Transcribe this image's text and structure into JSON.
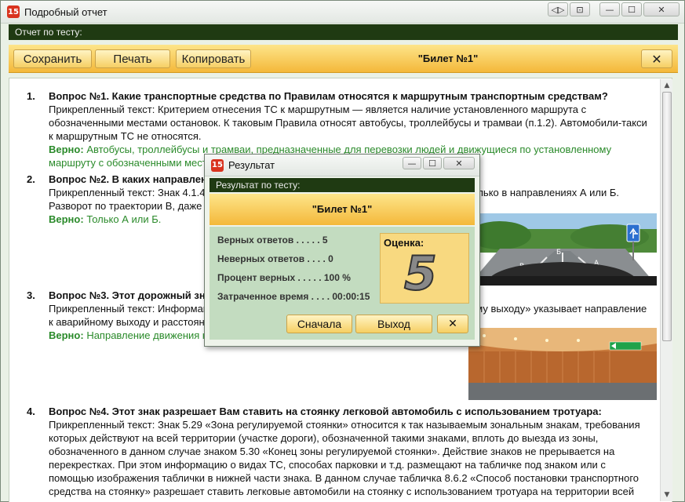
{
  "window": {
    "title": "Подробный отчет",
    "app_icon_text": "15",
    "controls": {
      "extra1": "◁▷",
      "extra2": "⊡",
      "min": "—",
      "max": "☐",
      "close": "✕"
    }
  },
  "report_header": "Отчет по тесту:",
  "toolbar": {
    "save": "Сохранить",
    "print": "Печать",
    "copy": "Копировать",
    "ticket": "\"Билет №1\"",
    "close": "✕"
  },
  "questions": [
    {
      "num": "1.",
      "title": "Вопрос №1. Какие транспортные средства по Правилам относятся к маршрутным транспортным средствам?",
      "text": "Прикрепленный текст: Критерием отнесения ТС к маршрутным — является наличие установленного маршрута с обозначенными местами остановок. К таковым Правила относят автобусы, троллейбусы и трамваи (п.1.2). Автомобили-такси к маршрутным ТС не относятся.",
      "correct_label": "Верно:",
      "correct": "Автобусы, троллейбусы и трамваи, предназначенные для перевозки людей и движущиеся по установленному маршруту с обозначенными местами остановок."
    },
    {
      "num": "2.",
      "title": "Вопрос №2. В каких направлениях Вам разрешено продолжить движение?",
      "text": "Прикрепленный текст: Знак 4.1.4 «Движение прямо или направо» разрешает движение только в направлениях А или Б. Разворот по траектории В, даже если это разрешено разметкой, запрещен.",
      "correct_label": "Верно:",
      "correct": "Только А или Б."
    },
    {
      "num": "3.",
      "title": "Вопрос №3. Этот дорожный знак указывает:",
      "text": "Прикрепленный текст: Информационный знак 6.18.3 «Направление движения к аварийному выходу» указывает направление к аварийному выходу и расстояние до него.",
      "correct_label": "Верно:",
      "correct": "Направление движения к аварийному выходу."
    },
    {
      "num": "4.",
      "title": "Вопрос №4. Этот знак разрешает Вам ставить на стоянку легковой автомобиль с использованием тротуара:",
      "text": "Прикрепленный текст: Знак 5.29 «Зона регулируемой стоянки» относится к так называемым зональным знакам, требования которых действуют на всей территории (участке дороги), обозначенной такими знаками, вплоть до выезда из зоны, обозначенного в данном случае знаком 5.30 «Конец зоны регулируемой стоянки». Действие знаков не прерывается на перекрестках. При этом информацию о видах ТС, способах парковки и т.д. размещают на табличке под знаком или с помощью изображения таблички в нижней части знака. В данном случае табличка 8.6.2 «Способ постановки транспортного средства на стоянку» разрешает ставить легковые автомобили на стоянку с использованием тротуара на территории всей"
    }
  ],
  "dialog": {
    "title": "Результат",
    "subheader": "Результат по тесту:",
    "ticket": "\"Билет №1\"",
    "stats": [
      {
        "label": "Верных ответов  . . . . . 5"
      },
      {
        "label": "Неверных ответов  . . . . 0"
      },
      {
        "label": "Процент верных  . . . . . 100 %"
      },
      {
        "label": "Затраченное время  . . . . 00:00:15"
      }
    ],
    "grade_label": "Оценка:",
    "grade_value": "5",
    "btn_restart": "Сначала",
    "btn_exit": "Выход",
    "btn_close": "✕"
  }
}
